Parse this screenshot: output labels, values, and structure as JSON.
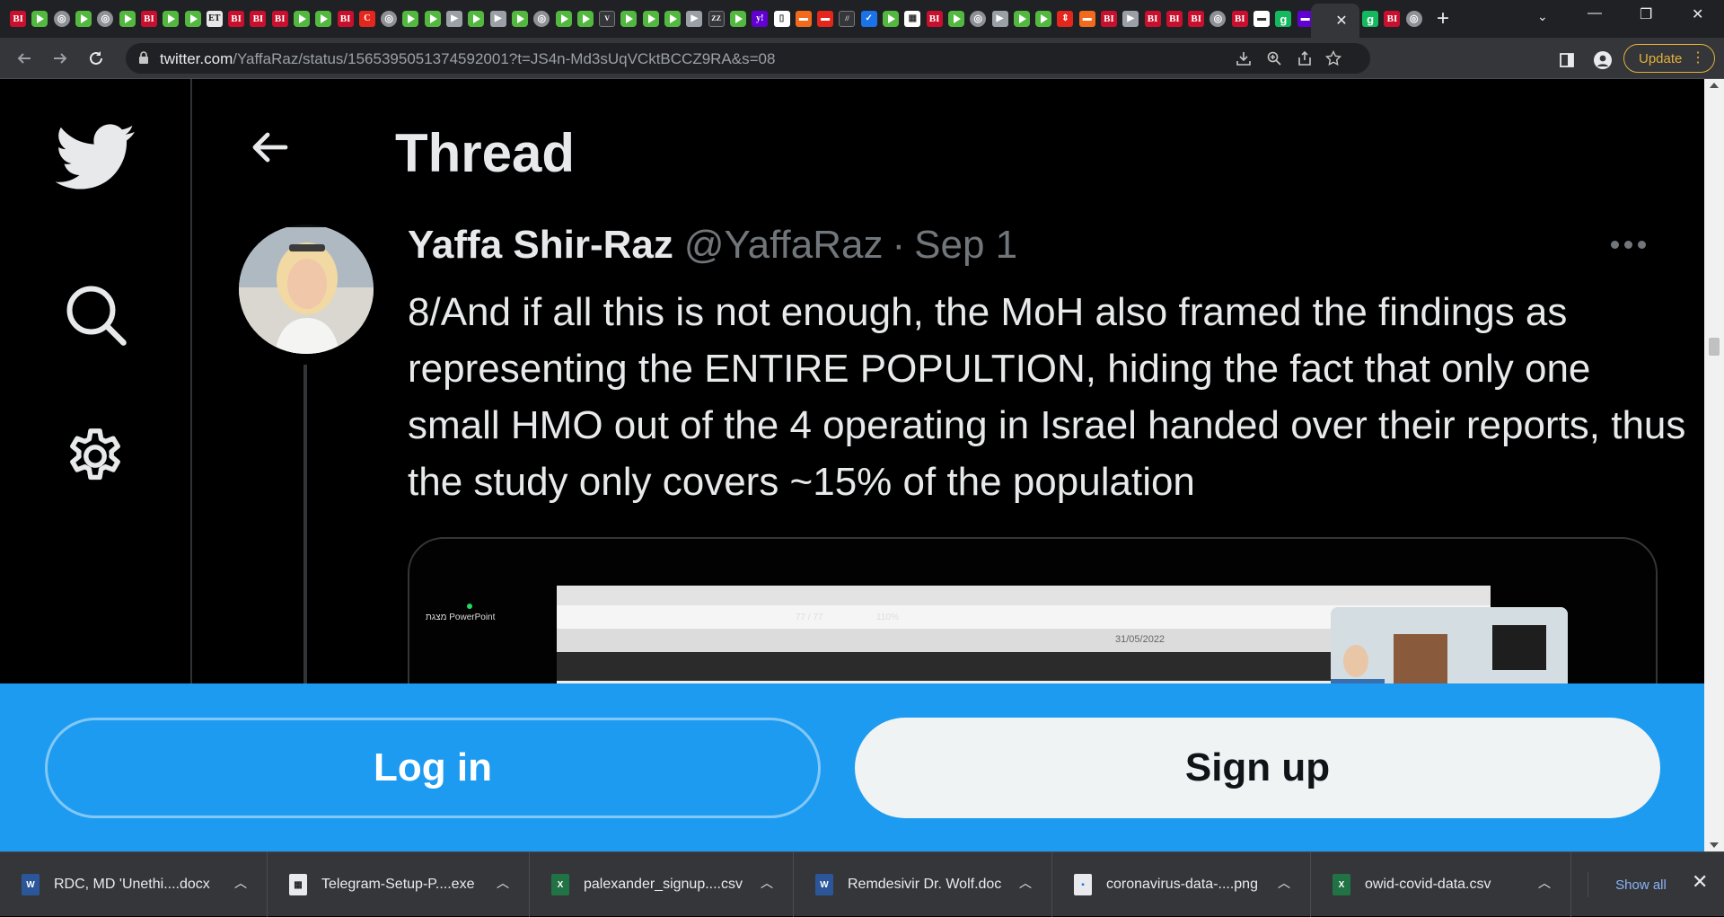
{
  "browser": {
    "tab_favicons": [
      {
        "type": "bi",
        "label": "BI"
      },
      {
        "type": "play",
        "label": ""
      },
      {
        "type": "globe",
        "label": "◎"
      },
      {
        "type": "play",
        "label": ""
      },
      {
        "type": "globe",
        "label": "◎"
      },
      {
        "type": "play",
        "label": ""
      },
      {
        "type": "bi",
        "label": "BI"
      },
      {
        "type": "play",
        "label": ""
      },
      {
        "type": "play",
        "label": ""
      },
      {
        "type": "et",
        "label": "ET"
      },
      {
        "type": "bi",
        "label": "BI"
      },
      {
        "type": "bi",
        "label": "BI"
      },
      {
        "type": "bi",
        "label": "BI"
      },
      {
        "type": "play",
        "label": ""
      },
      {
        "type": "play",
        "label": ""
      },
      {
        "type": "bi",
        "label": "BI"
      },
      {
        "type": "red",
        "label": "C"
      },
      {
        "type": "globe",
        "label": "◎"
      },
      {
        "type": "play",
        "label": ""
      },
      {
        "type": "play",
        "label": ""
      },
      {
        "type": "gray",
        "label": "▶"
      },
      {
        "type": "play",
        "label": ""
      },
      {
        "type": "gray",
        "label": "▶"
      },
      {
        "type": "play",
        "label": ""
      },
      {
        "type": "globe",
        "label": "◎"
      },
      {
        "type": "play",
        "label": ""
      },
      {
        "type": "play",
        "label": ""
      },
      {
        "type": "dark",
        "label": "V"
      },
      {
        "type": "play",
        "label": ""
      },
      {
        "type": "play",
        "label": ""
      },
      {
        "type": "play",
        "label": ""
      },
      {
        "type": "gray",
        "label": "▶"
      },
      {
        "type": "dark",
        "label": "ZZ"
      },
      {
        "type": "play",
        "label": ""
      },
      {
        "type": "purple",
        "label": "y!"
      },
      {
        "type": "white",
        "label": "▯"
      },
      {
        "type": "orange",
        "label": "▬"
      },
      {
        "type": "red",
        "label": "▬"
      },
      {
        "type": "dark",
        "label": "//"
      },
      {
        "type": "blue",
        "label": "✓"
      },
      {
        "type": "play",
        "label": ""
      },
      {
        "type": "white",
        "label": "▦"
      },
      {
        "type": "bi",
        "label": "BI"
      },
      {
        "type": "play",
        "label": ""
      },
      {
        "type": "globe",
        "label": "◎"
      },
      {
        "type": "gray",
        "label": "▶"
      },
      {
        "type": "play",
        "label": ""
      },
      {
        "type": "play",
        "label": ""
      },
      {
        "type": "red",
        "label": "⇕"
      },
      {
        "type": "orange",
        "label": "▬"
      },
      {
        "type": "bi",
        "label": "BI"
      },
      {
        "type": "gray",
        "label": "▶"
      },
      {
        "type": "bi",
        "label": "BI"
      },
      {
        "type": "bi",
        "label": "BI"
      },
      {
        "type": "bi",
        "label": "BI"
      },
      {
        "type": "globe",
        "label": "◎"
      },
      {
        "type": "bi",
        "label": "BI"
      },
      {
        "type": "white",
        "label": "▬"
      },
      {
        "type": "green",
        "label": "g"
      },
      {
        "type": "purple",
        "label": "▬"
      },
      {
        "type": "gray",
        "label": "▪"
      }
    ],
    "active_tab_close": "✕",
    "after_active_favicons": [
      {
        "type": "green",
        "label": "g"
      },
      {
        "type": "bi",
        "label": "BI"
      },
      {
        "type": "globe",
        "label": "◎"
      }
    ],
    "new_tab_label": "+",
    "tab_search_label": "⌄",
    "window_controls": {
      "minimize": "—",
      "restore": "❐",
      "close": "✕"
    },
    "url_host": "twitter.com",
    "url_path": "/YaffaRaz/status/1565395051374592001?t=JS4n-Md3sUqVCktBCCZ9RA&s=08",
    "update_label": "Update"
  },
  "twitter": {
    "header_title": "Thread",
    "tweet": {
      "author_name": "Yaffa Shir-Raz",
      "author_handle": "@YaffaRaz",
      "separator": "·",
      "date": "Sep 1",
      "text": "8/And if all this is not enough, the MoH also framed the findings as representing the ENTIRE POPULTION, hiding the fact that only one small HMO out of the 4 operating in Israel handed over their reports, thus the study only covers ~15% of the population"
    },
    "media": {
      "app_label": "מצגת PowerPoint",
      "page_counter": "77 / 77",
      "zoom": "110%",
      "date_label": "31/05/2022"
    },
    "login_label": "Log in",
    "signup_label": "Sign up"
  },
  "downloads": {
    "items": [
      {
        "name": "RDC, MD 'Unethi....docx",
        "kind": "word",
        "icon_label": "W"
      },
      {
        "name": "Telegram-Setup-P....exe",
        "kind": "exe",
        "icon_label": "▦"
      },
      {
        "name": "palexander_signup....csv",
        "kind": "excel",
        "icon_label": "X"
      },
      {
        "name": "Remdesivir Dr. Wolf.doc",
        "kind": "word",
        "icon_label": "W"
      },
      {
        "name": "coronavirus-data-....png",
        "kind": "png",
        "icon_label": "▪"
      },
      {
        "name": "owid-covid-data.csv",
        "kind": "excel",
        "icon_label": "X"
      }
    ],
    "show_all_label": "Show all",
    "close_label": "✕"
  },
  "colors": {
    "twitter_blue": "#1d9bf0",
    "text_primary": "#e7e9ea",
    "text_secondary": "#71767b",
    "update_accent": "#e0b13a"
  }
}
